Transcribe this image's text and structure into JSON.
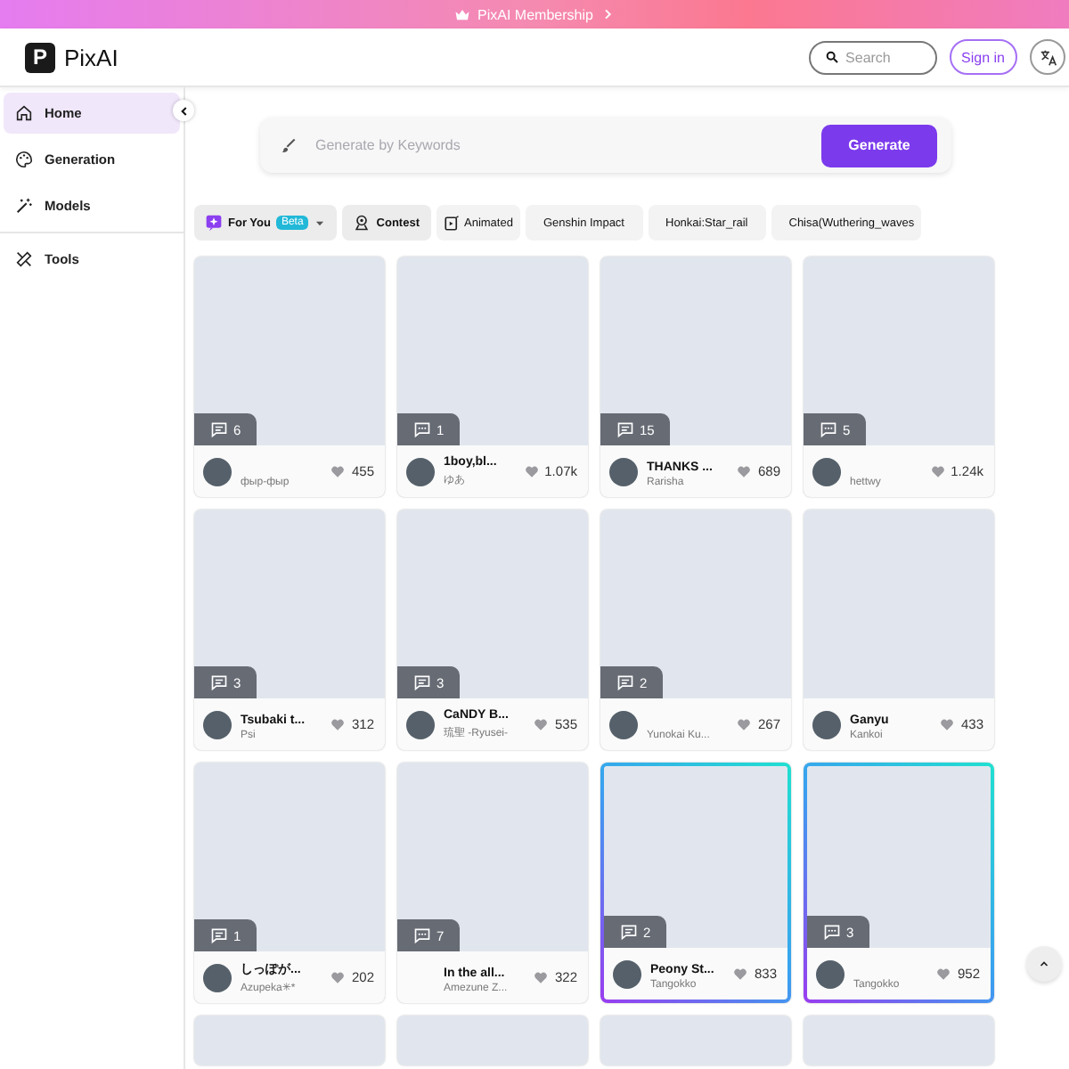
{
  "banner": {
    "label": "PixAI Membership"
  },
  "header": {
    "logo_letter": "P",
    "brand": "PixAI",
    "search": {
      "placeholder": "Search"
    },
    "sign_in": "Sign in"
  },
  "sidebar": {
    "items": [
      {
        "label": "Home",
        "selected": true,
        "divider_before": false
      },
      {
        "label": "Generation",
        "selected": false,
        "divider_before": false
      },
      {
        "label": "Models",
        "selected": false,
        "divider_before": false
      },
      {
        "label": "Tools",
        "selected": false,
        "divider_before": true
      }
    ]
  },
  "generate": {
    "placeholder": "Generate by Keywords",
    "button": "Generate"
  },
  "chips": [
    {
      "kind": "dropdown",
      "label": "For You",
      "badge": "Beta"
    },
    {
      "kind": "contest",
      "label": "Contest"
    },
    {
      "kind": "animated",
      "label": "Animated"
    },
    {
      "kind": "plain",
      "label": "Genshin Impact"
    },
    {
      "kind": "plain",
      "label": "Honkai:Star_rail"
    },
    {
      "kind": "plain",
      "label": "Chisa(Wuthering_waves"
    }
  ],
  "cards": [
    {
      "kind": "post",
      "comment_badge": {
        "kind": "lines",
        "count": "6"
      },
      "author": "фыр-фыр",
      "likes": "455",
      "avatar": true,
      "featured": false
    },
    {
      "kind": "post",
      "comment_badge": {
        "kind": "dots",
        "count": "1"
      },
      "title": "1boy,bl...",
      "author": "ゆあ",
      "likes": "1.07k",
      "avatar": true,
      "featured": false
    },
    {
      "kind": "post",
      "comment_badge": {
        "kind": "lines",
        "count": "15"
      },
      "title": "THANKS ...",
      "author": "Rarisha",
      "likes": "689",
      "avatar": true,
      "featured": false
    },
    {
      "kind": "post",
      "comment_badge": {
        "kind": "dots",
        "count": "5"
      },
      "author": "hettwy",
      "likes": "1.24k",
      "avatar": true,
      "featured": false
    },
    {
      "kind": "post",
      "comment_badge": {
        "kind": "lines",
        "count": "3"
      },
      "title": "Tsubaki t...",
      "author": "Psi",
      "likes": "312",
      "avatar": true,
      "featured": false
    },
    {
      "kind": "post",
      "comment_badge": {
        "kind": "lines",
        "count": "3"
      },
      "title": "CaNDY B...",
      "author": "琉聖 -Ryusei-",
      "likes": "535",
      "avatar": true,
      "featured": false
    },
    {
      "kind": "post",
      "comment_badge": {
        "kind": "lines",
        "count": "2"
      },
      "author": "Yunokai Ku...",
      "likes": "267",
      "avatar": true,
      "featured": false
    },
    {
      "kind": "post",
      "title": "Ganyu",
      "author": "Kankoi",
      "likes": "433",
      "avatar": true,
      "featured": false
    },
    {
      "kind": "post",
      "comment_badge": {
        "kind": "lines",
        "count": "1"
      },
      "title": "しっぽが...",
      "author": "Azupeka✳︎*",
      "likes": "202",
      "avatar": true,
      "featured": false
    },
    {
      "kind": "post",
      "comment_badge": {
        "kind": "dots",
        "count": "7"
      },
      "title": "In the all...",
      "author": "Amezune Z...",
      "likes": "322",
      "avatar": false,
      "featured": false
    },
    {
      "kind": "post",
      "comment_badge": {
        "kind": "lines",
        "count": "2"
      },
      "title": "Peony St...",
      "author": "Tangokko",
      "likes": "833",
      "avatar": true,
      "featured": true
    },
    {
      "kind": "post",
      "comment_badge": {
        "kind": "dots",
        "count": "3"
      },
      "author": "Tangokko",
      "likes": "952",
      "avatar": true,
      "featured": true
    },
    {
      "kind": "partial"
    },
    {
      "kind": "partial"
    },
    {
      "kind": "partial"
    },
    {
      "kind": "partial"
    }
  ]
}
